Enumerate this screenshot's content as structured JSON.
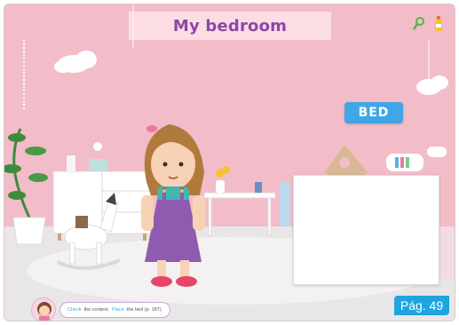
{
  "page": {
    "title": "My bedroom"
  },
  "toolbar": {
    "icons": [
      "magnifier-icon",
      "bottle-icon"
    ]
  },
  "scene": {
    "word_card": "BED",
    "instruction": {
      "verb1": "Check",
      "text1": "the context.",
      "verb2": "Place",
      "text2": "the bed (p. 187)."
    }
  },
  "footer": {
    "page_label": "Pág. 49"
  },
  "colors": {
    "wall": "#f2bcc8",
    "floor": "#e8e6e7",
    "title": "#8e46a8",
    "accent": "#1fa4e0"
  }
}
